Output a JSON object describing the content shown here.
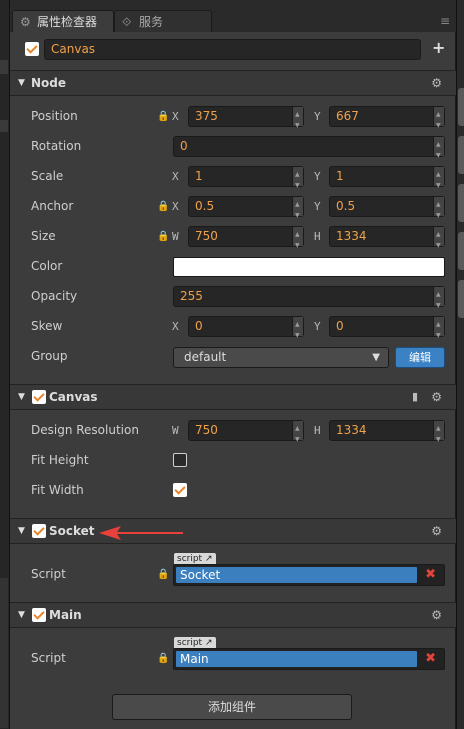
{
  "tabs": [
    {
      "label": "属性检查器",
      "icon": "gear-icon"
    },
    {
      "label": "服务",
      "icon": "link-icon"
    }
  ],
  "node": {
    "name": "Canvas",
    "enabled": true
  },
  "sections": {
    "node": {
      "title": "Node",
      "position": {
        "label": "Position",
        "x_axis": "X",
        "x": "375",
        "y_axis": "Y",
        "y": "667"
      },
      "rotation": {
        "label": "Rotation",
        "value": "0"
      },
      "scale": {
        "label": "Scale",
        "x_axis": "X",
        "x": "1",
        "y_axis": "Y",
        "y": "1"
      },
      "anchor": {
        "label": "Anchor",
        "x_axis": "X",
        "x": "0.5",
        "y_axis": "Y",
        "y": "0.5"
      },
      "size": {
        "label": "Size",
        "w_axis": "W",
        "w": "750",
        "h_axis": "H",
        "h": "1334"
      },
      "color": {
        "label": "Color",
        "value": "#ffffff"
      },
      "opacity": {
        "label": "Opacity",
        "value": "255"
      },
      "skew": {
        "label": "Skew",
        "x_axis": "X",
        "x": "0",
        "y_axis": "Y",
        "y": "0"
      },
      "group": {
        "label": "Group",
        "value": "default",
        "edit_label": "编辑"
      }
    },
    "canvas": {
      "title": "Canvas",
      "enabled": true,
      "design_resolution": {
        "label": "Design Resolution",
        "w_axis": "W",
        "w": "750",
        "h_axis": "H",
        "h": "1334"
      },
      "fit_height": {
        "label": "Fit Height",
        "checked": false
      },
      "fit_width": {
        "label": "Fit Width",
        "checked": true
      }
    },
    "socket": {
      "title": "Socket",
      "enabled": true,
      "script": {
        "label": "Script",
        "tag": "script",
        "value": "Socket"
      }
    },
    "main": {
      "title": "Main",
      "enabled": true,
      "script": {
        "label": "Script",
        "tag": "script",
        "value": "Main"
      }
    }
  },
  "add_component_label": "添加组件",
  "colors": {
    "accent": "#f0a24a",
    "selection": "#3b7fbf",
    "arrow": "#e8403a",
    "remove": "#e0443a"
  }
}
